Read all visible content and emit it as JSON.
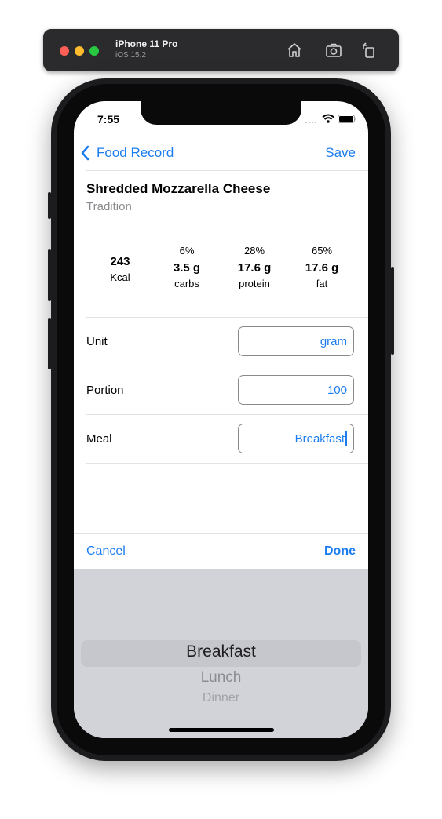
{
  "simulator": {
    "device_name": "iPhone 11 Pro",
    "os_version": "iOS 15.2",
    "icons": [
      "home-icon",
      "screenshot-icon",
      "rotate-icon"
    ],
    "traffic_light_colors": [
      "#fe5f57",
      "#febc2e",
      "#28c840"
    ]
  },
  "status_bar": {
    "time": "7:55",
    "icons": [
      "signal-icon",
      "wifi-icon",
      "battery-icon"
    ]
  },
  "nav": {
    "back_label": "Food Record",
    "save_label": "Save",
    "accent": "#1a7cf0"
  },
  "food": {
    "name": "Shredded Mozzarella Cheese",
    "brand": "Tradition"
  },
  "nutrition": {
    "kcal": {
      "value": "243",
      "label": "Kcal"
    },
    "carbs": {
      "percent": "6%",
      "value": "3.5 g",
      "label": "carbs"
    },
    "protein": {
      "percent": "28%",
      "value": "17.6 g",
      "label": "protein"
    },
    "fat": {
      "percent": "65%",
      "value": "17.6 g",
      "label": "fat"
    }
  },
  "form": {
    "unit": {
      "label": "Unit",
      "value": "gram"
    },
    "portion": {
      "label": "Portion",
      "value": "100"
    },
    "meal": {
      "label": "Meal",
      "value": "Breakfast"
    }
  },
  "accessory": {
    "cancel_label": "Cancel",
    "done_label": "Done"
  },
  "picker": {
    "options": [
      "Breakfast",
      "Lunch",
      "Dinner"
    ],
    "selected": "Breakfast"
  }
}
